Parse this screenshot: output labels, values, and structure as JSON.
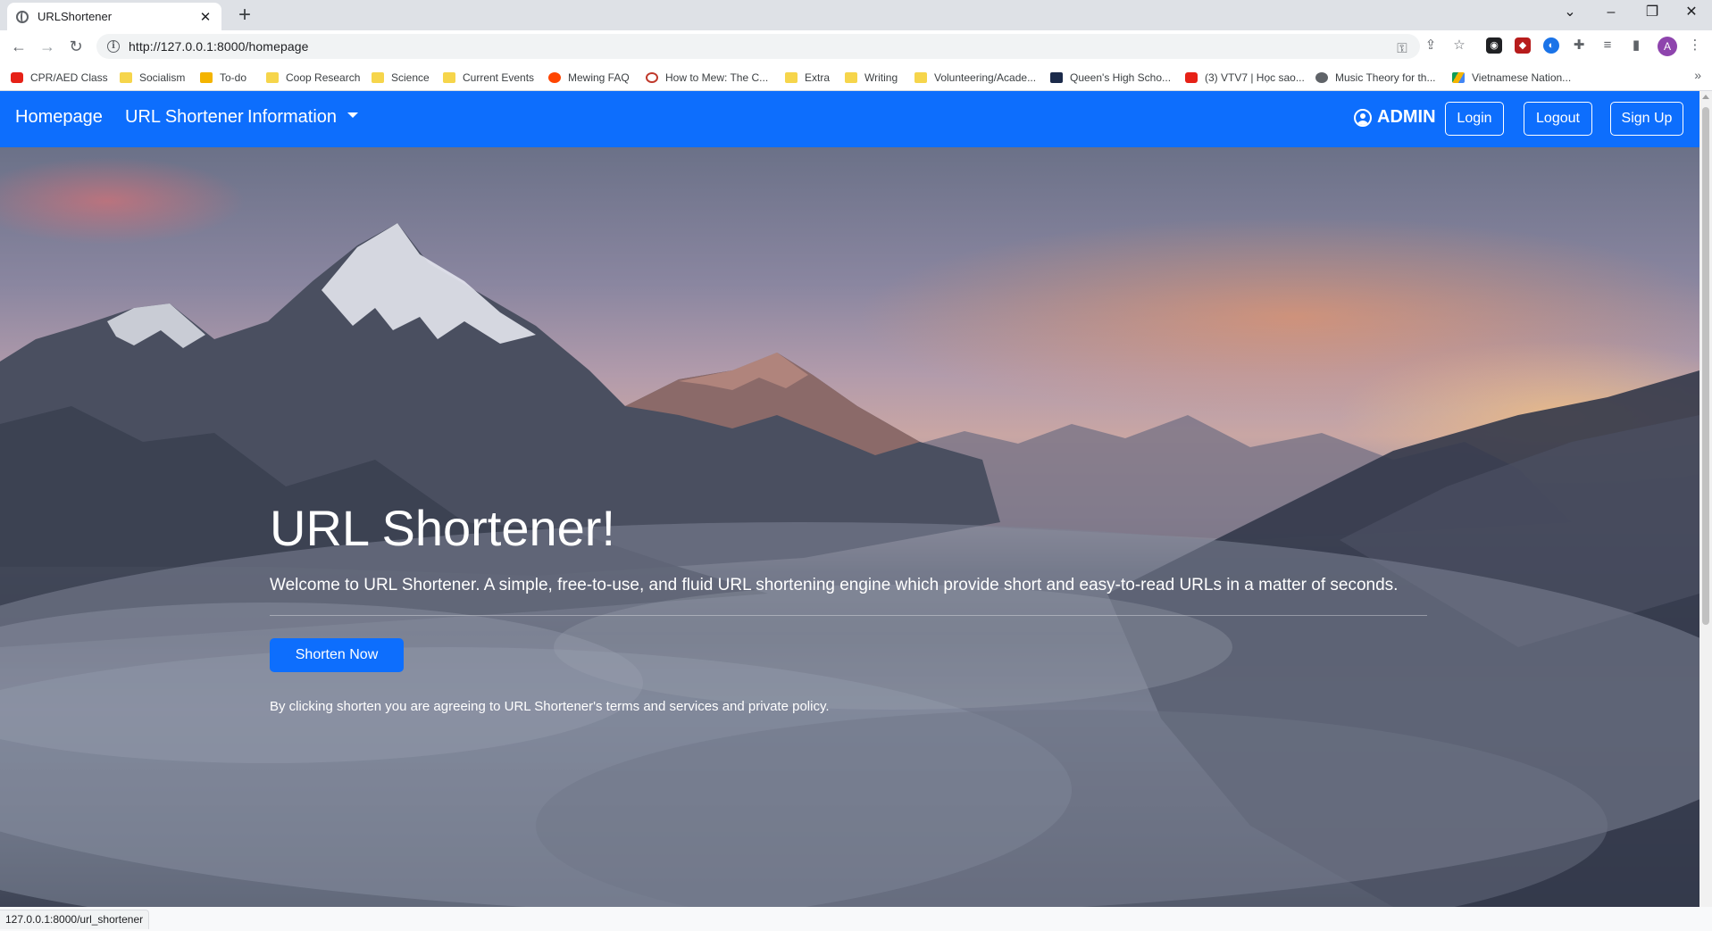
{
  "browser": {
    "tab_title": "URLShortener",
    "new_tab": "+",
    "url": "http://127.0.0.1:8000/homepage",
    "status_url": "127.0.0.1:8000/url_shortener",
    "profile_initial": "A",
    "window_controls": {
      "tab_list": "⌄",
      "minimize": "–",
      "restore": "❐",
      "close": "✕"
    }
  },
  "bookmarks": [
    {
      "label": "CPR/AED Class",
      "icon": "youtube-icon"
    },
    {
      "label": "Socialism",
      "icon": "folder-icon"
    },
    {
      "label": "To-do",
      "icon": "classroom-icon"
    },
    {
      "label": "Coop Research",
      "icon": "folder-icon"
    },
    {
      "label": "Science",
      "icon": "folder-icon"
    },
    {
      "label": "Current Events",
      "icon": "folder-icon"
    },
    {
      "label": "Mewing FAQ",
      "icon": "reddit-icon"
    },
    {
      "label": "How to Mew: The C...",
      "icon": "site-icon"
    },
    {
      "label": "Extra",
      "icon": "folder-icon"
    },
    {
      "label": "Writing",
      "icon": "folder-icon"
    },
    {
      "label": "Volunteering/Acade...",
      "icon": "folder-icon"
    },
    {
      "label": "Queen's High Scho...",
      "icon": "school-icon"
    },
    {
      "label": "(3) VTV7 | Học sao...",
      "icon": "youtube-icon"
    },
    {
      "label": "Music Theory for th...",
      "icon": "globe-icon"
    },
    {
      "label": "Vietnamese Nation...",
      "icon": "drive-icon"
    }
  ],
  "navbar": {
    "homepage": "Homepage",
    "url_shortener": "URL Shortener",
    "information": "Information",
    "user": "ADMIN",
    "login": "Login",
    "logout": "Logout",
    "signup": "Sign Up",
    "color": "#0d6efd"
  },
  "hero": {
    "title": "URL Shortener!",
    "lead": "Welcome to URL Shortener. A simple, free-to-use, and fluid URL shortening engine which provide short and easy-to-read URLs in a matter of seconds.",
    "cta": "Shorten Now",
    "terms": "By clicking shorten you are agreeing to URL Shortener's terms and services and private policy."
  }
}
